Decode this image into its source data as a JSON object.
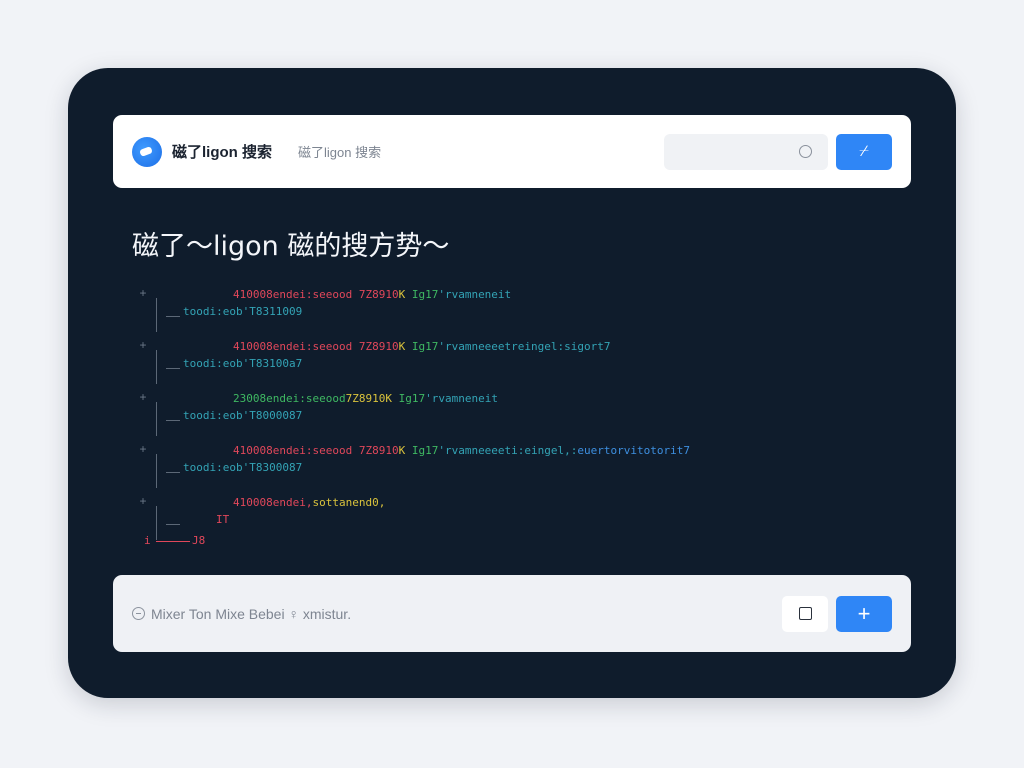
{
  "header": {
    "brand": "磁了ligon 搜索",
    "subtitle": "磁了ligon 搜索",
    "search": {
      "value": "",
      "placeholder": ""
    },
    "go_glyph": "⌿",
    "accent": "#2f86f6"
  },
  "heading": "磁了～ligon 磁的搜方势～",
  "tree": {
    "nodes": [
      {
        "toggle": "+",
        "segments": [
          {
            "text": "410008endei:seeood 7Z8910",
            "color": "red"
          },
          {
            "text": "K ",
            "color": "yellow"
          },
          {
            "text": "Ig17",
            "color": "green"
          },
          {
            "text": "'rvamneneit",
            "color": "teal"
          }
        ],
        "child": "toodi:eob'T8311009"
      },
      {
        "toggle": "+",
        "segments": [
          {
            "text": "410008endei:seeood 7Z8910",
            "color": "red"
          },
          {
            "text": "K ",
            "color": "yellow"
          },
          {
            "text": "Ig17",
            "color": "green"
          },
          {
            "text": "'rvamneeeetreingel:sigort7",
            "color": "teal"
          }
        ],
        "child": "toodi:eob'T83100a7"
      },
      {
        "toggle": "+",
        "segments": [
          {
            "text": "23008endei:seeood",
            "color": "green"
          },
          {
            "text": "7Z8910",
            "color": "yellow"
          },
          {
            "text": "K ",
            "color": "yellow"
          },
          {
            "text": "Ig17",
            "color": "green"
          },
          {
            "text": "'rvamneneit",
            "color": "teal"
          }
        ],
        "child": "toodi:eob'T8000087"
      },
      {
        "toggle": "+",
        "segments": [
          {
            "text": "410008endei:seeood 7Z8910",
            "color": "red"
          },
          {
            "text": "K ",
            "color": "yellow"
          },
          {
            "text": "Ig17",
            "color": "green"
          },
          {
            "text": "'rvamneeeeti:eingel,:",
            "color": "teal"
          },
          {
            "text": "euertorvitotorit7",
            "color": "blue"
          }
        ],
        "child": "toodi:eob'T8300087"
      },
      {
        "toggle": "+",
        "segments": [
          {
            "text": "410008endei,",
            "color": "red"
          },
          {
            "text": "sottanend0,",
            "color": "yellow"
          }
        ],
        "child": "IT"
      }
    ],
    "footer": {
      "left": "i",
      "right": "J8"
    },
    "colors": {
      "red": "#e0475a",
      "yellow": "#d9c23c",
      "green": "#3fb862",
      "teal": "#33a3b5",
      "blue": "#3d8fe0"
    }
  },
  "footer_bar": {
    "status_text": "Mixer Ton  Mixe  Bebei  ♀ xmistur.",
    "square_button": "",
    "add_glyph": "+"
  }
}
